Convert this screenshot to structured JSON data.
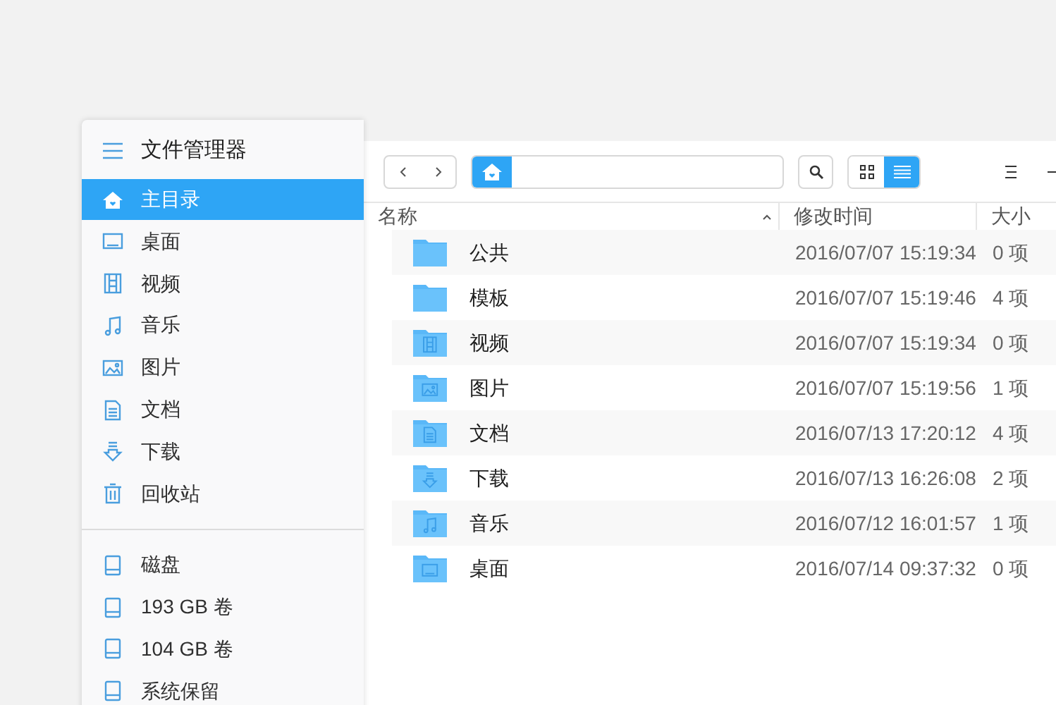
{
  "sidebar": {
    "title": "文件管理器",
    "items": [
      {
        "label": "主目录",
        "kind": "home",
        "selected": true
      },
      {
        "label": "桌面",
        "kind": "desktop",
        "selected": false
      },
      {
        "label": "视频",
        "kind": "video",
        "selected": false
      },
      {
        "label": "音乐",
        "kind": "music",
        "selected": false
      },
      {
        "label": "图片",
        "kind": "picture",
        "selected": false
      },
      {
        "label": "文档",
        "kind": "document",
        "selected": false
      },
      {
        "label": "下载",
        "kind": "download",
        "selected": false
      },
      {
        "label": "回收站",
        "kind": "trash",
        "selected": false
      }
    ],
    "disks": [
      {
        "label": "磁盘",
        "selected": false
      },
      {
        "label": "193 GB 卷",
        "selected": false
      },
      {
        "label": "104 GB 卷",
        "selected": false
      },
      {
        "label": "系统保留",
        "selected": false
      }
    ]
  },
  "toolbar": {
    "view_modes": [
      {
        "kind": "grid",
        "selected": false
      },
      {
        "kind": "list",
        "selected": true
      }
    ]
  },
  "table": {
    "columns": [
      "名称",
      "修改时间",
      "大小"
    ],
    "rows": [
      {
        "name": "公共",
        "kind": "plain",
        "modified": "2016/07/07 15:19:34",
        "size": "0 项"
      },
      {
        "name": "模板",
        "kind": "plain",
        "modified": "2016/07/07 15:19:46",
        "size": "4 项"
      },
      {
        "name": "视频",
        "kind": "video",
        "modified": "2016/07/07 15:19:34",
        "size": "0 项"
      },
      {
        "name": "图片",
        "kind": "picture",
        "modified": "2016/07/07 15:19:56",
        "size": "1 项"
      },
      {
        "name": "文档",
        "kind": "document",
        "modified": "2016/07/13 17:20:12",
        "size": "4 项"
      },
      {
        "name": "下载",
        "kind": "download",
        "modified": "2016/07/13 16:26:08",
        "size": "2 项"
      },
      {
        "name": "音乐",
        "kind": "music",
        "modified": "2016/07/12 16:01:57",
        "size": "1 项"
      },
      {
        "name": "桌面",
        "kind": "desktop",
        "modified": "2016/07/14 09:37:32",
        "size": "0 项"
      }
    ]
  }
}
